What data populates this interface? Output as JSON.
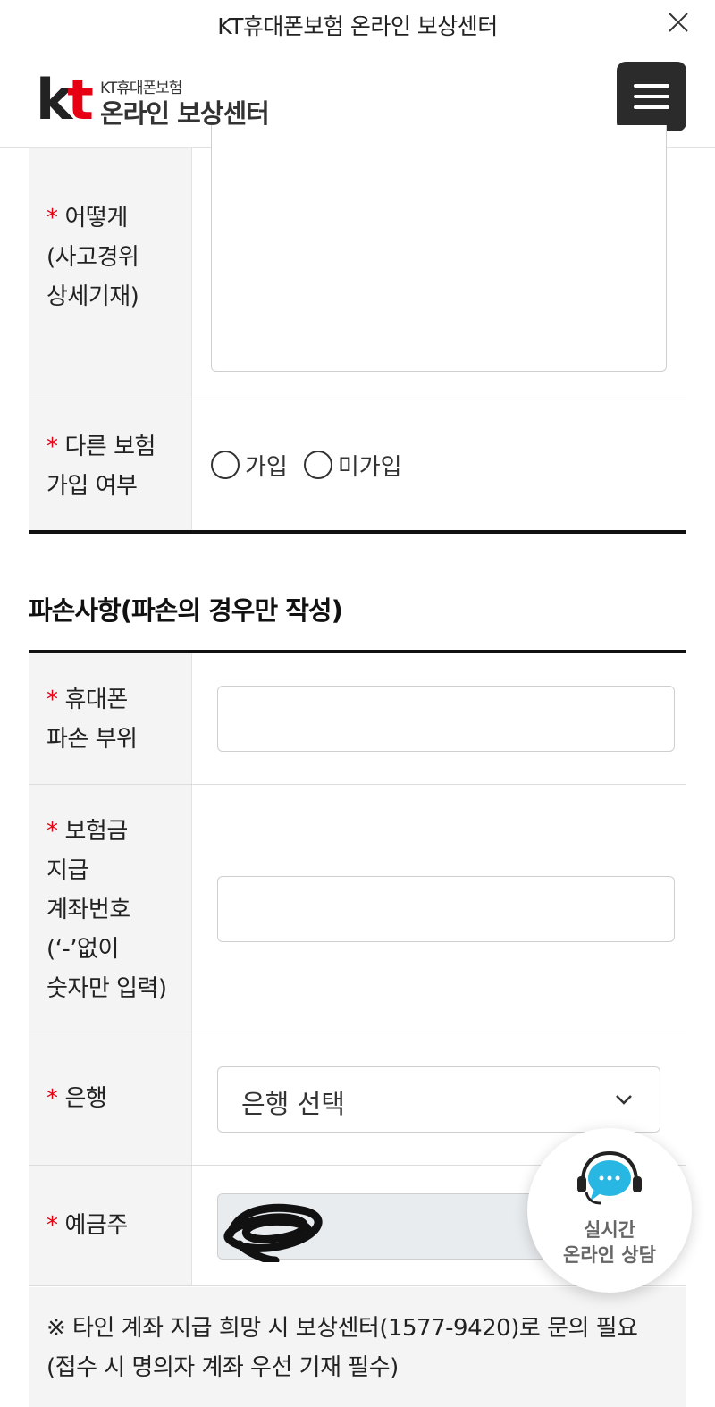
{
  "topbar": {
    "title": "KT휴대폰보험 온라인 보상센터"
  },
  "header": {
    "logo_mark": "kt",
    "logo_small": "KT휴대폰보험",
    "logo_big": "온라인 보상센터"
  },
  "form_top": {
    "how_label": "어떻게\n(사고경위\n상세기재)",
    "other_insurance_label": "다른 보험\n가입 여부",
    "radio_options": [
      "가입",
      "미가입"
    ]
  },
  "damage_section": {
    "title": "파손사항(파손의 경우만 작성)",
    "damage_part_label": "휴대폰\n파손 부위",
    "account_label": "보험금\n지급\n계좌번호\n(‘-’없이\n숫자만 입력)",
    "bank_label": "은행",
    "bank_select_value": "은행 선택",
    "holder_label": "예금주",
    "required_mark": "*"
  },
  "note": {
    "text": "※ 타인 계좌 지급 희망 시 보상센터(1577-9420)로 문의 필요\n(접수 시 명의자 계좌 우선 기재 필수)"
  },
  "chat_widget": {
    "line1": "실시간",
    "line2": "온라인 상담"
  },
  "colors": {
    "required": "#e60012",
    "menu_button": "#2b2b2b",
    "chat_bubble": "#28b7e3",
    "label_bg": "#f4f4f4"
  }
}
